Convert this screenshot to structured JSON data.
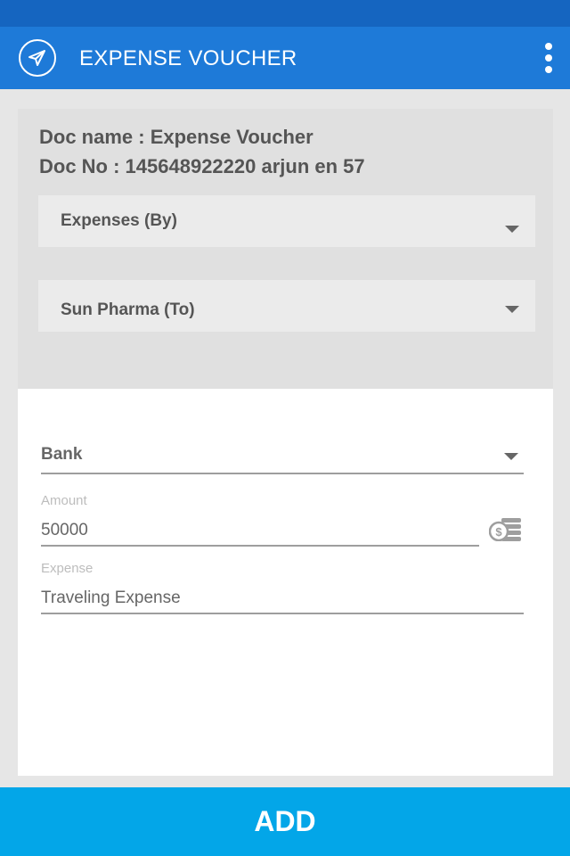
{
  "app_bar": {
    "title": "EXPENSE VOUCHER",
    "nav_icon": "send-icon",
    "menu_icon": "more-vert-icon"
  },
  "document": {
    "name_line": "Doc name : Expense Voucher",
    "number_line": "Doc No : 145648922220 arjun en 57"
  },
  "dropdowns": {
    "by": "Expenses (By)",
    "to": "Sun Pharma (To)"
  },
  "form": {
    "payment_mode": {
      "value": "Bank"
    },
    "amount": {
      "hint": "Amount",
      "value": "50000",
      "icon": "coins-dollar-icon"
    },
    "expense": {
      "hint": "Expense",
      "value": "Traveling Expense"
    }
  },
  "actions": {
    "add_label": "ADD"
  },
  "colors": {
    "status_bar": "#1565c0",
    "app_bar": "#1e7ad8",
    "add_button": "#03a6e8",
    "card_bg": "#e0e0e0",
    "text_dark": "#555555"
  }
}
